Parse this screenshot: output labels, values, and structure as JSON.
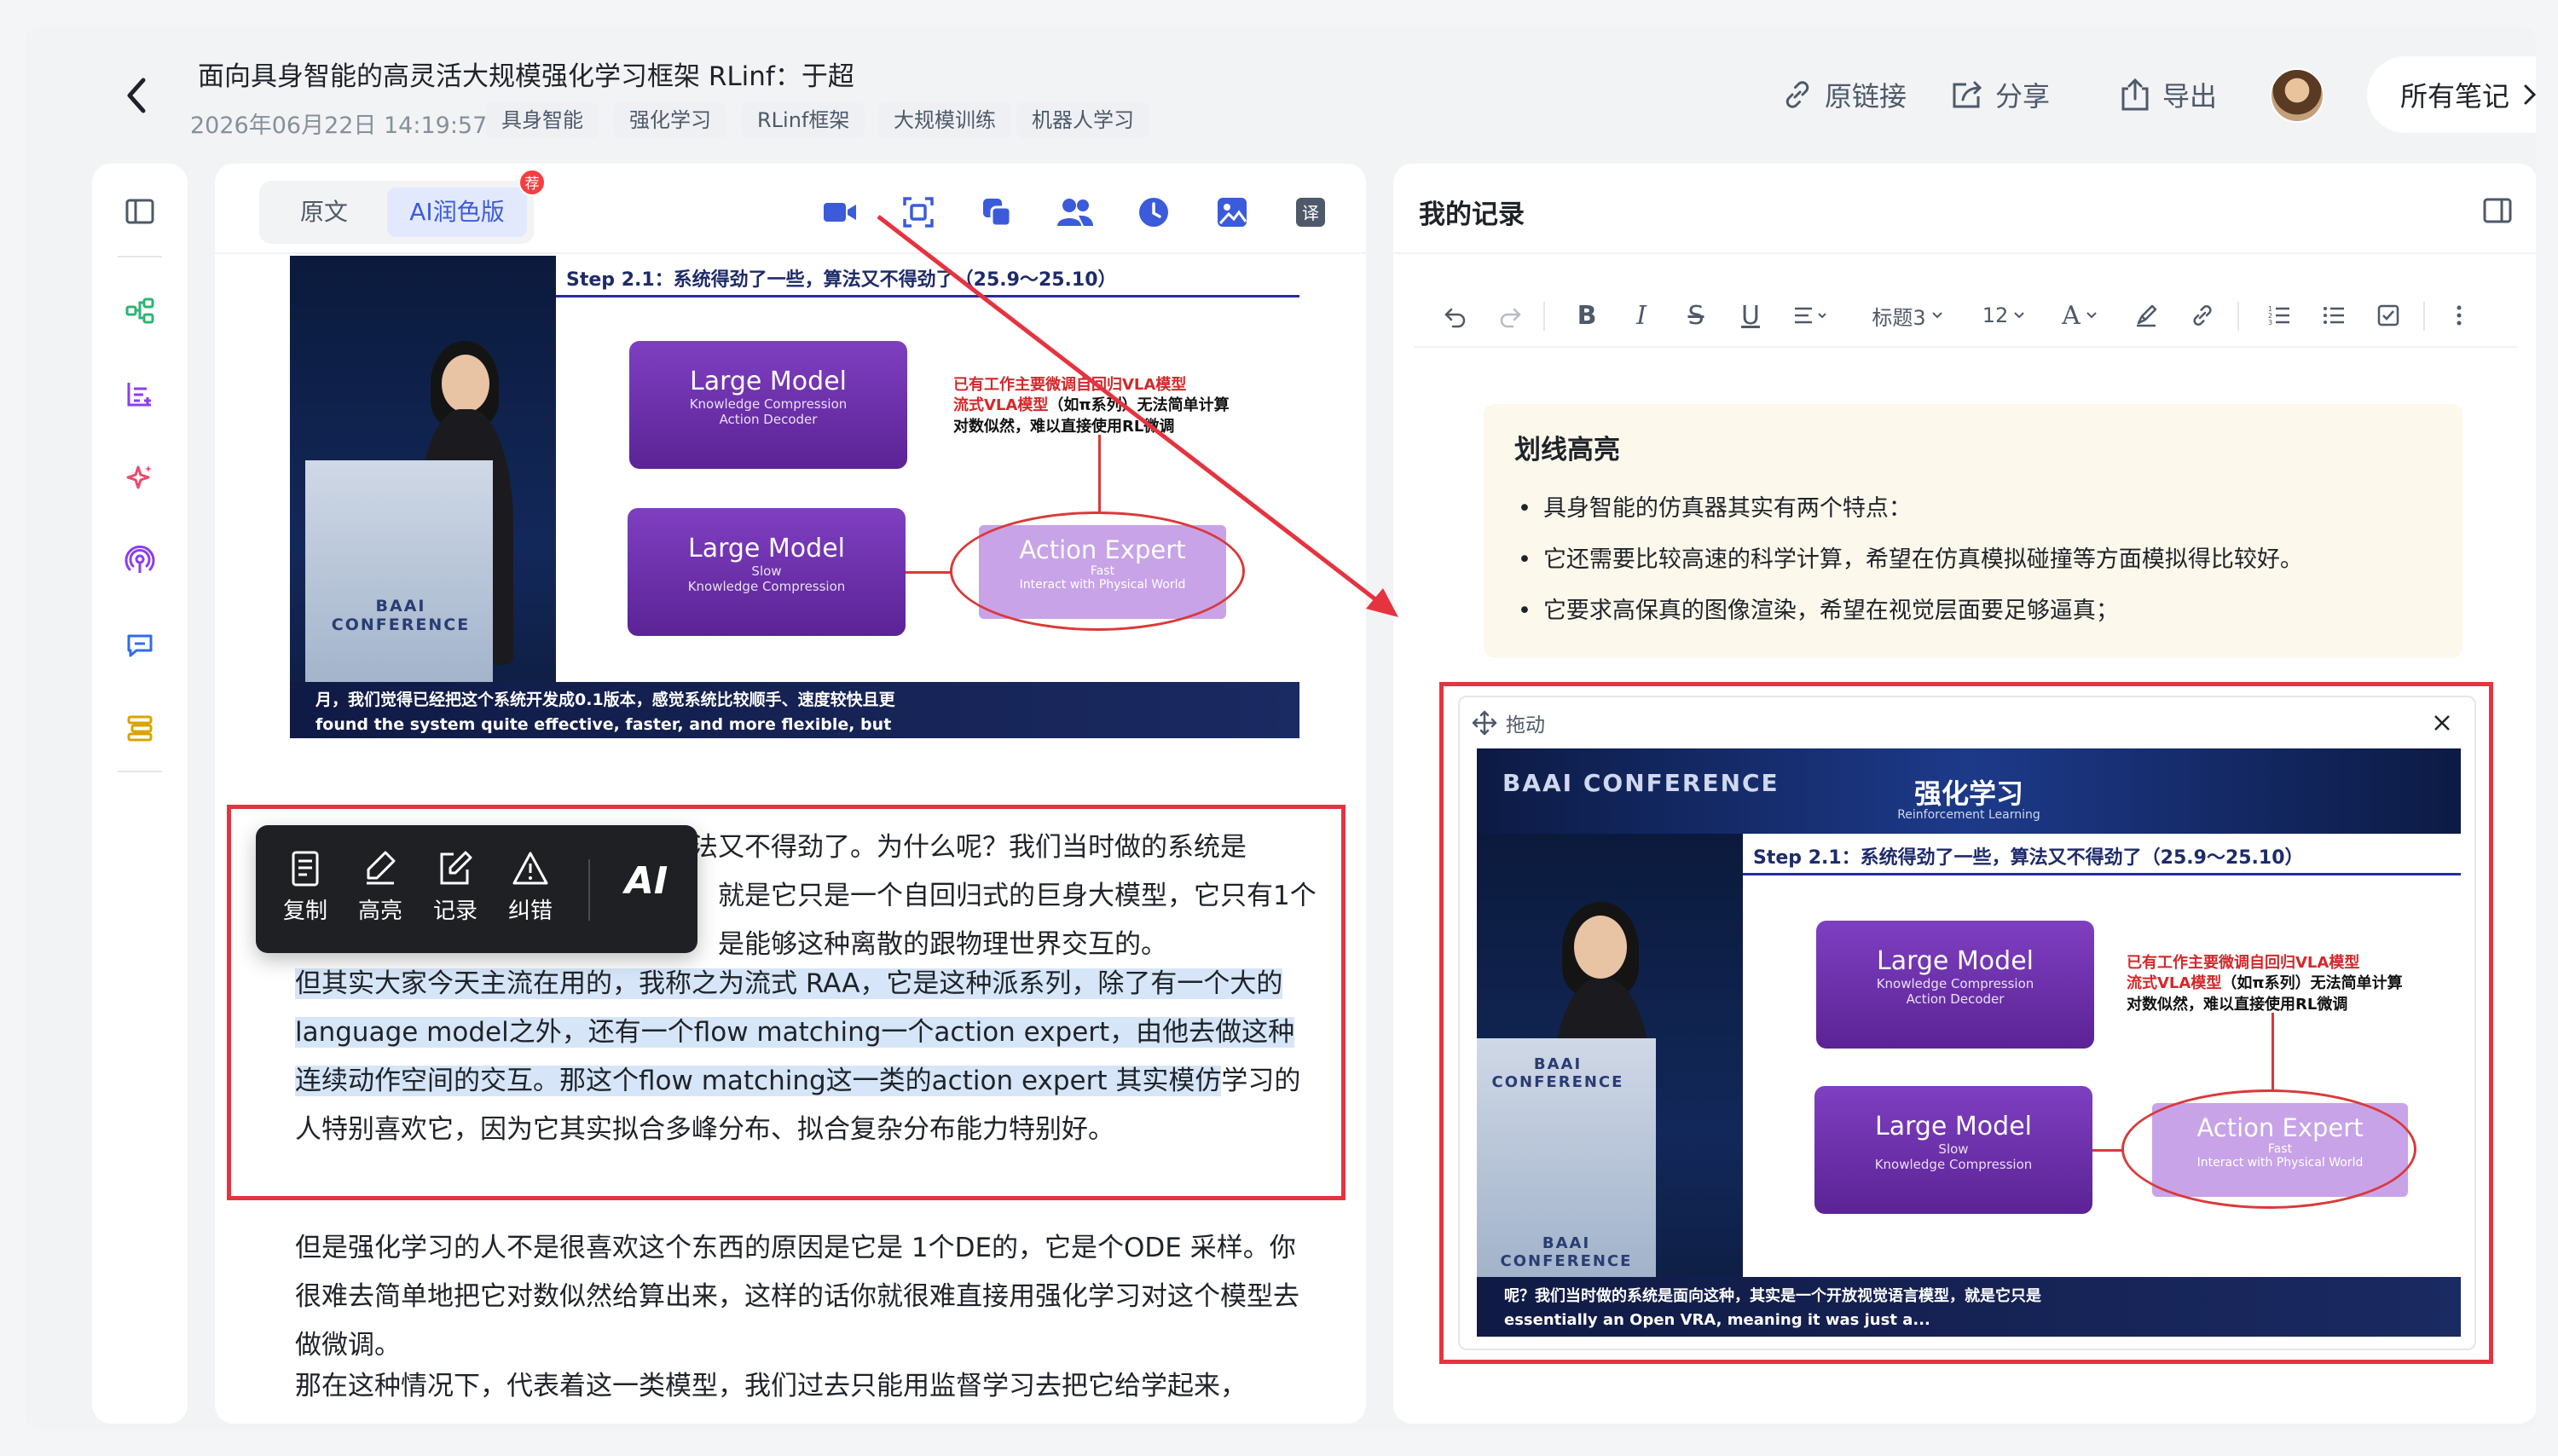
{
  "header": {
    "title": "面向具身智能的高灵活大规模强化学习框架 RLinf：于超",
    "date": "2026年06月22日 14:19:57",
    "tags": [
      "具身智能",
      "强化学习",
      "RLinf框架",
      "大规模训练",
      "机器人学习"
    ],
    "actions": {
      "source_link": "原链接",
      "share": "分享",
      "export": "导出"
    },
    "all_notes": "所有笔记"
  },
  "main": {
    "tabs": {
      "original": "原文",
      "ai_polished": "AI润色版"
    },
    "badge": "荐",
    "slide": {
      "step": "Step 2.1：系统得劲了一些，算法又不得劲了（25.9～25.10）",
      "box1_title": "Large Model",
      "box1_items": [
        "Knowledge Compression",
        "Action Decoder"
      ],
      "box2_title": "Large Model",
      "box2_items": [
        "Slow",
        "Knowledge Compression"
      ],
      "expert_title": "Action Expert",
      "expert_items": [
        "Fast",
        "Interact with Physical World"
      ],
      "note_red": "已有工作主要微调自回归VLA模型",
      "note_line2_red": "流式VLA模型",
      "note_line2": "（如π系列）无法简单计算",
      "note_line3": "对数似然，难以直接使用RL微调",
      "caption_cn": "月，我们觉得已经把这个系统开发成0.1版本，感觉系统比较顺手、速度较快且更",
      "caption_en": "found the system quite effective, faster, and more flexible, but",
      "logo": "BAAI CONFERENCE"
    },
    "paragraphs": {
      "p1_a": "但是紧接着发现另一个问题叫做算法又不得劲了。为什么呢？我们当时做的系统是",
      "p1_b": "就是它只是一个自回归式的巨身大模型，它只有1个",
      "p1_c": "是能够这种离散的跟物理世界交互的。",
      "p2": "但其实大家今天主流在用的，我称之为流式 RAA，它是这种派系列，除了有一个大的language model之外，还有一个flow matching一个action expert，由他去做这种连续动作空间的交互。那这个flow matching这一类的action expert 其实模仿",
      "p2_tail": "学习的人特别喜欢它，因为它其实拟合多峰分布、拟合复杂分布能力特别好。",
      "p3": "但是强化学习的人不是很喜欢这个东西的原因是它是 1个DE的，它是个ODE 采样。你很难去简单地把它对数似然给算出来，这样的话你就很难直接用强化学习对这个模型去做微调。",
      "p4": "那在这种情况下，代表着这一类模型，我们过去只能用监督学习去把它给学起来，"
    },
    "float_toolbar": {
      "copy": "复制",
      "highlight": "高亮",
      "note": "记录",
      "correct": "纠错",
      "ai": "AI"
    }
  },
  "notes_panel": {
    "title": "我的记录",
    "toolbar": {
      "heading": "标题3",
      "font_size": "12"
    },
    "highlight_card": {
      "title": "划线高亮",
      "items": [
        "具身智能的仿真器其实有两个特点：",
        "它还需要比较高速的科学计算，希望在仿真模拟碰撞等方面模拟得比较好。",
        "它要求高保真的图像渲染，希望在视觉层面要足够逼真；"
      ]
    },
    "image_card": {
      "drag_label": "拖动",
      "banner_title": "强化学习",
      "banner_sub": "Reinforcement Learning",
      "caption_cn": "呢？我们当时做的系统是面向这种，其实是一个开放视觉语言模型，就是它只是",
      "caption_en": "essentially an Open VRA, meaning it was just a..."
    }
  },
  "colors": {
    "accent": "#3b5bdb",
    "purple": "#6b2fb3",
    "highlight_red": "#e5333f",
    "selection": "#d6e6f8"
  }
}
